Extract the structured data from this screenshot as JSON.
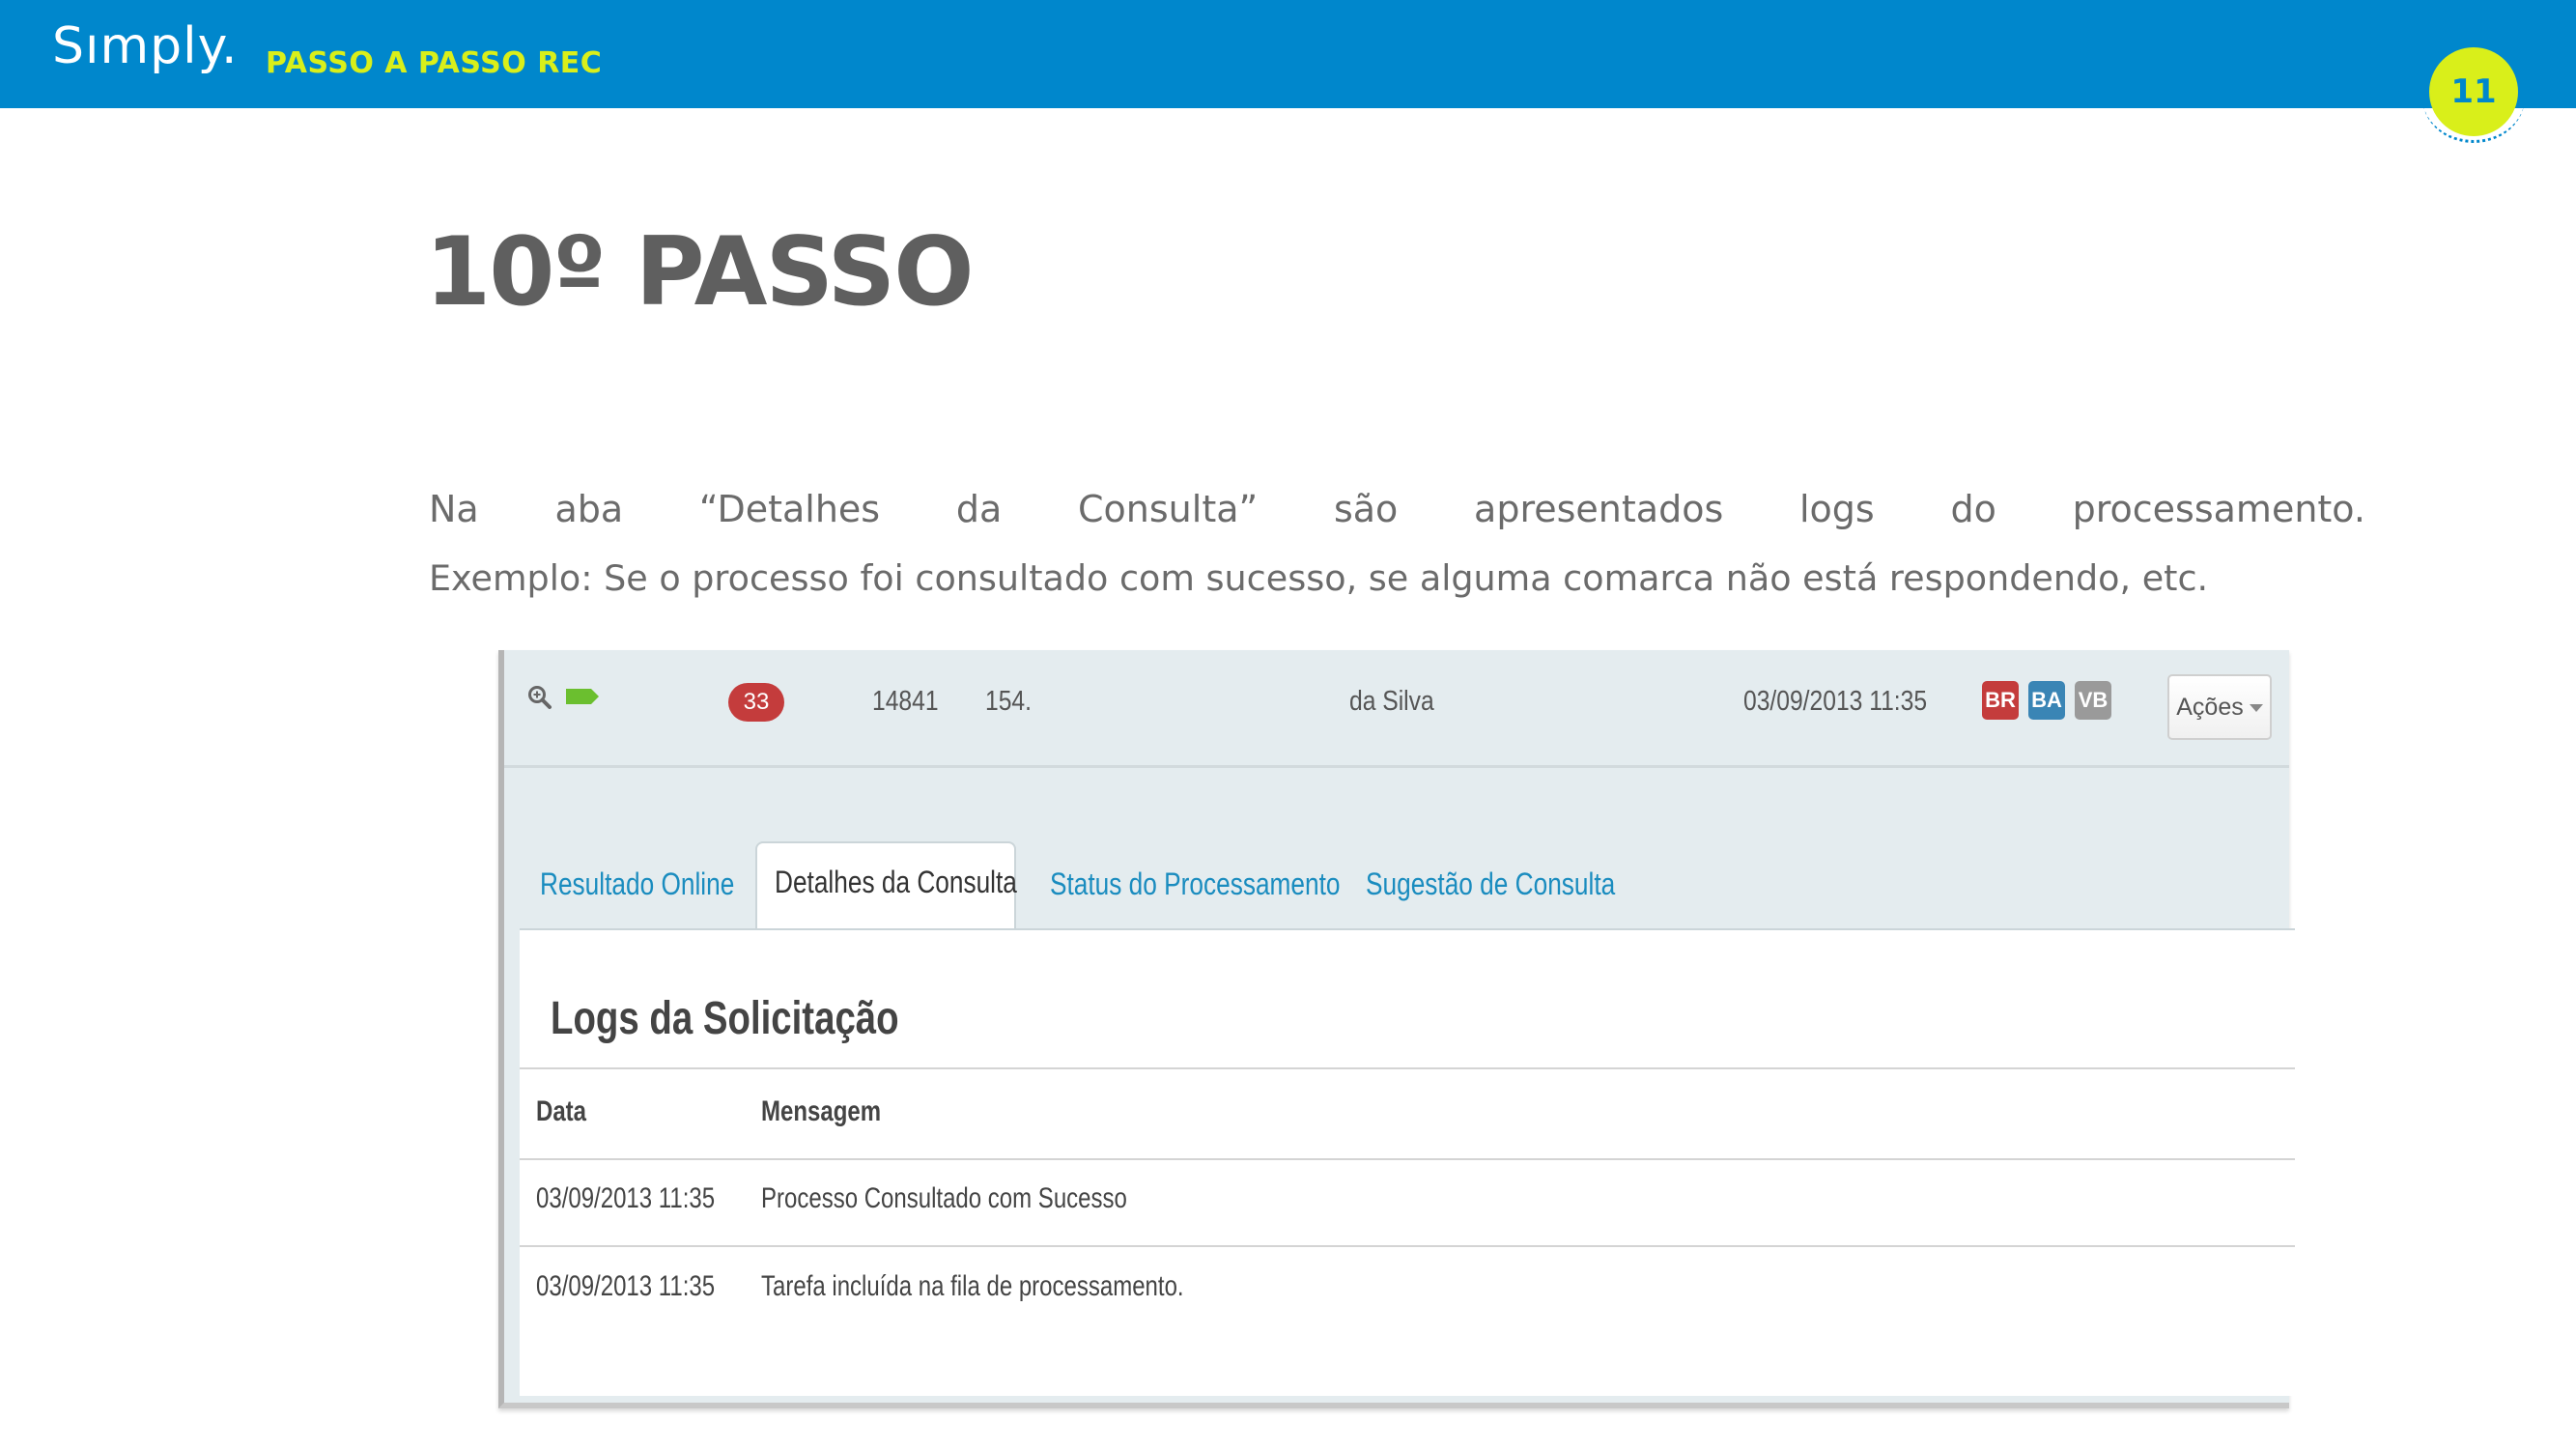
{
  "header": {
    "brand": "Sımply",
    "brand_dot": ".",
    "subtitle": "PASSO A PASSO REC",
    "page_number": "11",
    "bar_color": "#0087cc",
    "accent_color": "#d9ef1a"
  },
  "slide": {
    "title": "10º PASSO",
    "paragraph_line1_words": [
      "Na",
      "aba",
      "“Detalhes",
      "da",
      "Consulta”",
      "são",
      "apresentados",
      "logs",
      "do",
      "processamento."
    ],
    "paragraph_line2": "Exemplo: Se o processo foi consultado com sucesso, se alguma comarca não está respondendo, etc."
  },
  "screenshot": {
    "row": {
      "icons": [
        "zoom-icon",
        "tag-icon"
      ],
      "count_badge": "33",
      "id": "14841",
      "process": "154.",
      "name": "da Silva",
      "datetime": "03/09/2013 11:35",
      "labels": [
        {
          "text": "BR",
          "color": "#c43c3c"
        },
        {
          "text": "BA",
          "color": "#3a85b5"
        },
        {
          "text": "VB",
          "color": "#9a9a9a"
        }
      ],
      "actions_label": "Ações"
    },
    "tabs": [
      {
        "label": "Resultado Online",
        "active": false
      },
      {
        "label": "Detalhes da Consulta",
        "active": true
      },
      {
        "label": "Status do Processamento",
        "active": false
      },
      {
        "label": "Sugestão de Consulta",
        "active": false
      }
    ],
    "panel": {
      "title": "Logs da Solicitação",
      "columns": [
        "Data",
        "Mensagem"
      ],
      "rows": [
        {
          "date": "03/09/2013 11:35",
          "message": "Processo Consultado com Sucesso"
        },
        {
          "date": "03/09/2013 11:35",
          "message": "Tarefa incluída na fila de processamento."
        }
      ]
    }
  }
}
